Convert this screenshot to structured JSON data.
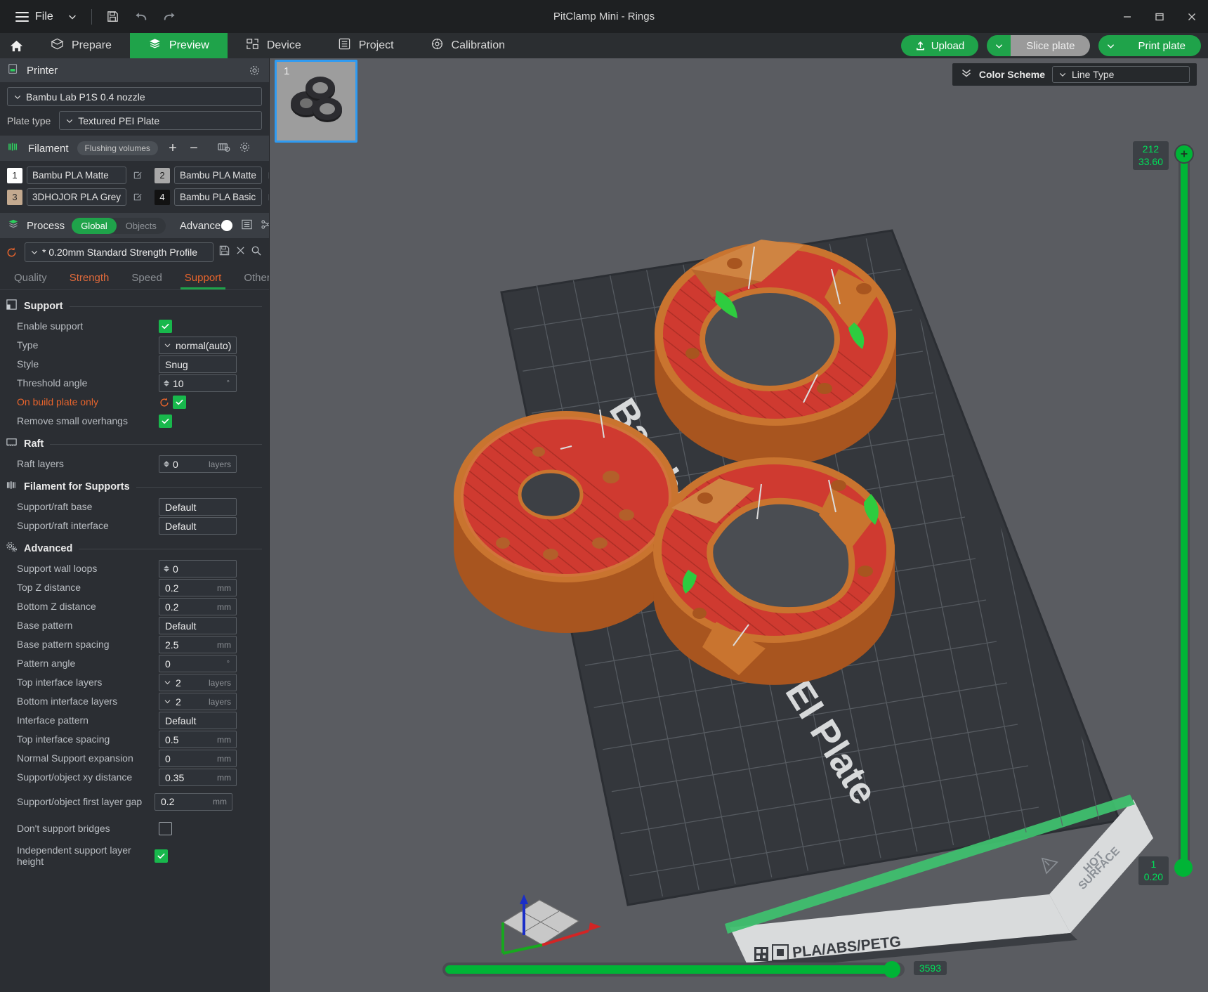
{
  "titlebar": {
    "file_label": "File",
    "title": "PitClamp Mini - Rings",
    "minimize": "─",
    "maximize": "▭",
    "close": "✕"
  },
  "nav": {
    "tabs": [
      {
        "label": "Prepare",
        "icon": "cube-icon",
        "active": false
      },
      {
        "label": "Preview",
        "icon": "layers-icon",
        "active": true
      },
      {
        "label": "Device",
        "icon": "device-icon",
        "active": false
      },
      {
        "label": "Project",
        "icon": "list-icon",
        "active": false
      },
      {
        "label": "Calibration",
        "icon": "target-icon",
        "active": false
      }
    ]
  },
  "actions": {
    "upload": "Upload",
    "slice_plate": "Slice plate",
    "print_plate": "Print plate"
  },
  "color_scheme": {
    "label": "Color Scheme",
    "value": "Line Type"
  },
  "printer": {
    "section_title": "Printer",
    "model": "Bambu Lab P1S 0.4 nozzle",
    "plate_type_label": "Plate type",
    "plate_type": "Textured PEI Plate"
  },
  "filament": {
    "section_title": "Filament",
    "flushing_volumes": "Flushing volumes",
    "add": "+",
    "remove": "−",
    "items": [
      {
        "num": "1",
        "name": "Bambu PLA Matte",
        "swatch": "#ffffff",
        "numcolor": "#222222"
      },
      {
        "num": "2",
        "name": "Bambu PLA Matte",
        "swatch": "#a8a8a8",
        "numcolor": "#1b1b1b"
      },
      {
        "num": "3",
        "name": "3DHOJOR PLA Grey",
        "swatch": "#c3a98f",
        "numcolor": "#2a2a2a"
      },
      {
        "num": "4",
        "name": "Bambu PLA Basic",
        "swatch": "#121212",
        "numcolor": "#e8e8e8"
      }
    ]
  },
  "process": {
    "section_title": "Process",
    "scope_global": "Global",
    "scope_objects": "Objects",
    "advanced_label": "Advanced",
    "advanced_on": true,
    "profile": "* 0.20mm Standard Strength Profile",
    "tabs": [
      {
        "label": "Quality",
        "state": "normal"
      },
      {
        "label": "Strength",
        "state": "modified"
      },
      {
        "label": "Speed",
        "state": "normal"
      },
      {
        "label": "Support",
        "state": "active"
      },
      {
        "label": "Others",
        "state": "normal"
      }
    ]
  },
  "support_page": {
    "groups": [
      {
        "title": "Support",
        "icon": "support-icon",
        "rows": [
          {
            "name": "Enable support",
            "type": "checkbox",
            "checked": true,
            "modified": false
          },
          {
            "name": "Type",
            "type": "select",
            "value": "normal(auto)",
            "modified": false
          },
          {
            "name": "Style",
            "type": "text",
            "value": "Snug",
            "modified": false
          },
          {
            "name": "Threshold angle",
            "type": "spinner",
            "value": "10",
            "unit": "°",
            "modified": false
          },
          {
            "name": "On build plate only",
            "type": "checkbox",
            "checked": true,
            "modified": true,
            "revert": true
          },
          {
            "name": "Remove small overhangs",
            "type": "checkbox",
            "checked": true,
            "modified": false
          }
        ]
      },
      {
        "title": "Raft",
        "icon": "raft-icon",
        "rows": [
          {
            "name": "Raft layers",
            "type": "spinner",
            "value": "0",
            "unit": "layers",
            "modified": false
          }
        ]
      },
      {
        "title": "Filament for Supports",
        "icon": "filament-icon",
        "rows": [
          {
            "name": "Support/raft base",
            "type": "text",
            "value": "Default",
            "modified": false
          },
          {
            "name": "Support/raft interface",
            "type": "text",
            "value": "Default",
            "modified": false
          }
        ]
      },
      {
        "title": "Advanced",
        "icon": "gears-icon",
        "rows": [
          {
            "name": "Support wall loops",
            "type": "spinner",
            "value": "0",
            "unit": "",
            "modified": false
          },
          {
            "name": "Top Z distance",
            "type": "text",
            "value": "0.2",
            "unit": "mm",
            "modified": false
          },
          {
            "name": "Bottom Z distance",
            "type": "text",
            "value": "0.2",
            "unit": "mm",
            "modified": false
          },
          {
            "name": "Base pattern",
            "type": "text",
            "value": "Default",
            "modified": false
          },
          {
            "name": "Base pattern spacing",
            "type": "text",
            "value": "2.5",
            "unit": "mm",
            "modified": false
          },
          {
            "name": "Pattern angle",
            "type": "text",
            "value": "0",
            "unit": "°",
            "modified": false
          },
          {
            "name": "Top interface layers",
            "type": "dropnum",
            "value": "2",
            "unit": "layers",
            "modified": false
          },
          {
            "name": "Bottom interface layers",
            "type": "dropnum",
            "value": "2",
            "unit": "layers",
            "modified": false
          },
          {
            "name": "Interface pattern",
            "type": "text",
            "value": "Default",
            "modified": false
          },
          {
            "name": "Top interface spacing",
            "type": "text",
            "value": "0.5",
            "unit": "mm",
            "modified": false
          },
          {
            "name": "Normal Support expansion",
            "type": "text",
            "value": "0",
            "unit": "mm",
            "modified": false
          },
          {
            "name": "Support/object xy distance",
            "type": "text",
            "value": "0.35",
            "unit": "mm",
            "modified": false
          },
          {
            "name": "Support/object first layer gap",
            "type": "text",
            "value": "0.2",
            "unit": "mm",
            "modified": false
          },
          {
            "name": "Don't support bridges",
            "type": "checkbox",
            "checked": false,
            "modified": false
          },
          {
            "name": "Independent support layer height",
            "type": "checkbox",
            "checked": true,
            "modified": false
          }
        ]
      }
    ]
  },
  "viewport": {
    "plate_thumb_number": "1",
    "bed_label": "Bambu Textured PEI Plate",
    "bed_edge_label": "PLA/ABS/PETG",
    "hot_surface_label": "HOT SURFACE",
    "layer_slider": {
      "top_layer": "212",
      "top_height": "33.60",
      "bottom_layer": "1",
      "bottom_height": "0.20"
    },
    "move_slider": {
      "value": "3593"
    }
  },
  "colors": {
    "accent_green": "#1fa34a",
    "bright_green": "#00b436",
    "orange_accent": "#e8642c",
    "model_orange": "#d1743a",
    "support_red": "#c0392b",
    "viewport_bg": "#5a5c61"
  }
}
